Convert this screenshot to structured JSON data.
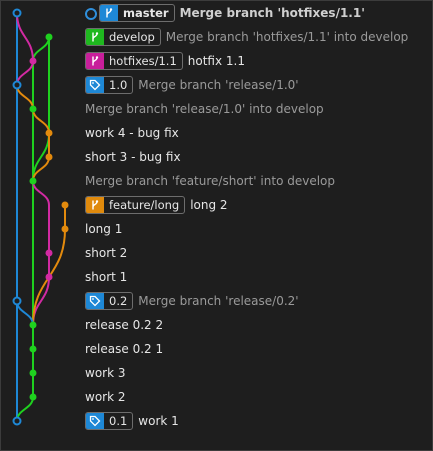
{
  "colors": {
    "blue": "#1e88d6",
    "green": "#1fd11f",
    "magenta": "#d22aa2",
    "orange": "#e38a0d",
    "master_badge": "#1e88d6",
    "develop_badge": "#1fb81f",
    "hotfix_badge": "#c81f9b",
    "tag_badge": "#1e88d6",
    "feature_badge": "#e08a0c"
  },
  "commits": [
    {
      "id": "c0",
      "message": "Merge branch 'hotfixes/1.1'",
      "style": "head",
      "refs": [
        {
          "type": "branch",
          "name": "master",
          "color": "master_badge",
          "bold": true,
          "icon": "branch-icon"
        }
      ]
    },
    {
      "id": "c1",
      "message": "Merge branch 'hotfixes/1.1' into develop",
      "style": "dim",
      "refs": [
        {
          "type": "branch",
          "name": "develop",
          "color": "develop_badge",
          "icon": "branch-icon"
        }
      ]
    },
    {
      "id": "c2",
      "message": "hotfix 1.1",
      "style": "normal",
      "refs": [
        {
          "type": "branch",
          "name": "hotfixes/1.1",
          "color": "hotfix_badge",
          "icon": "branch-icon"
        }
      ]
    },
    {
      "id": "c3",
      "message": "Merge branch 'release/1.0'",
      "style": "dim",
      "refs": [
        {
          "type": "tag",
          "name": "1.0",
          "color": "tag_badge",
          "icon": "tag-icon"
        }
      ]
    },
    {
      "id": "c4",
      "message": "Merge branch 'release/1.0' into develop",
      "style": "dim",
      "refs": []
    },
    {
      "id": "c5",
      "message": "work 4 - bug fix",
      "style": "normal",
      "refs": []
    },
    {
      "id": "c6",
      "message": "short 3 - bug fix",
      "style": "normal",
      "refs": []
    },
    {
      "id": "c7",
      "message": "Merge branch 'feature/short' into develop",
      "style": "dim",
      "refs": []
    },
    {
      "id": "c8",
      "message": "long 2",
      "style": "normal",
      "refs": [
        {
          "type": "branch",
          "name": "feature/long",
          "color": "feature_badge",
          "icon": "branch-icon"
        }
      ]
    },
    {
      "id": "c9",
      "message": "long 1",
      "style": "normal",
      "refs": []
    },
    {
      "id": "c10",
      "message": "short 2",
      "style": "normal",
      "refs": []
    },
    {
      "id": "c11",
      "message": "short 1",
      "style": "normal",
      "refs": []
    },
    {
      "id": "c12",
      "message": "Merge branch 'release/0.2'",
      "style": "dim",
      "refs": [
        {
          "type": "tag",
          "name": "0.2",
          "color": "tag_badge",
          "icon": "tag-icon"
        }
      ]
    },
    {
      "id": "c13",
      "message": "release 0.2 2",
      "style": "normal",
      "refs": []
    },
    {
      "id": "c14",
      "message": "release 0.2 1",
      "style": "normal",
      "refs": []
    },
    {
      "id": "c15",
      "message": "work 3",
      "style": "normal",
      "refs": []
    },
    {
      "id": "c16",
      "message": "work 2",
      "style": "normal",
      "refs": []
    },
    {
      "id": "c17",
      "message": "work 1",
      "style": "normal",
      "refs": [
        {
          "type": "tag",
          "name": "0.1",
          "color": "tag_badge",
          "icon": "tag-icon"
        }
      ]
    }
  ]
}
